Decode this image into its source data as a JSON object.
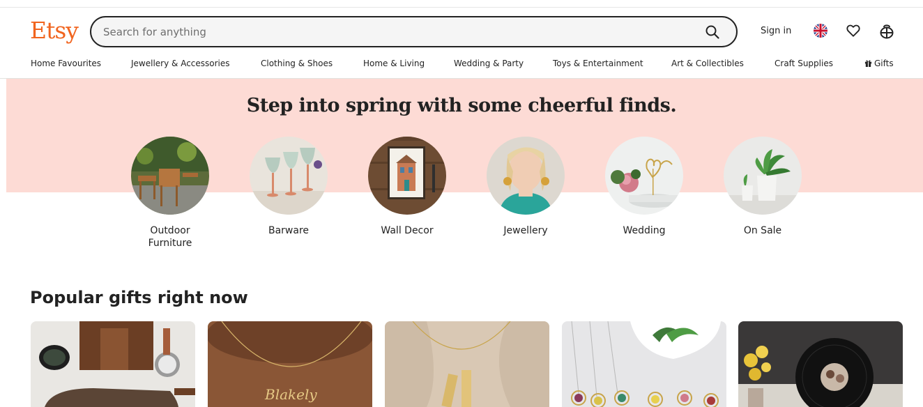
{
  "header": {
    "logo": "Etsy",
    "search_placeholder": "Search for anything",
    "sign_in": "Sign in"
  },
  "nav": {
    "items": [
      "Home Favourites",
      "Jewellery & Accessories",
      "Clothing & Shoes",
      "Home & Living",
      "Wedding & Party",
      "Toys & Entertainment",
      "Art & Collectibles",
      "Craft Supplies",
      "Gifts"
    ]
  },
  "hero": {
    "title": "Step into spring with some cheerful finds.",
    "circles": [
      {
        "label": "Outdoor Furniture"
      },
      {
        "label": "Barware"
      },
      {
        "label": "Wall Decor"
      },
      {
        "label": "Jewellery"
      },
      {
        "label": "Wedding"
      },
      {
        "label": "On Sale"
      }
    ]
  },
  "section": {
    "title": "Popular gifts right now"
  },
  "colors": {
    "brand": "#f1641e",
    "hero_bg": "#fddbd5",
    "text": "#222222"
  },
  "icons": [
    "search-icon",
    "uk-flag-icon",
    "heart-icon",
    "shopping-bag-icon",
    "gift-icon"
  ]
}
